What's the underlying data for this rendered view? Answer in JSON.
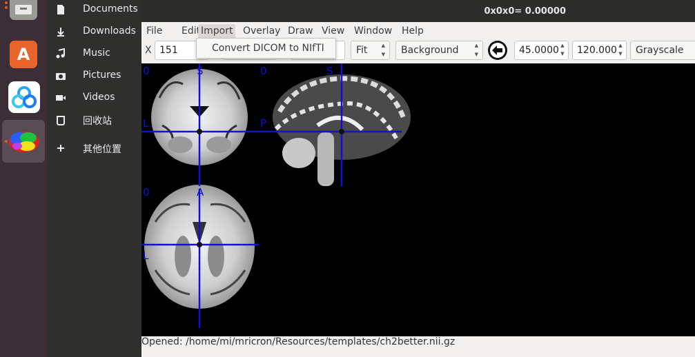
{
  "dock": {
    "apps": [
      {
        "name": "files-app-icon",
        "active": false,
        "running": true
      },
      {
        "name": "software-center-icon",
        "active": false,
        "running": false
      },
      {
        "name": "baidu-netdisk-icon",
        "active": false,
        "running": false
      },
      {
        "name": "mricron-app-icon",
        "active": true,
        "running": true
      }
    ]
  },
  "sidebar": {
    "items": [
      {
        "label": "Documents",
        "icon": "document-icon"
      },
      {
        "label": "Downloads",
        "icon": "download-icon"
      },
      {
        "label": "Music",
        "icon": "music-icon"
      },
      {
        "label": "Pictures",
        "icon": "camera-icon"
      },
      {
        "label": "Videos",
        "icon": "video-icon"
      },
      {
        "label": "回收站",
        "icon": "trash-icon"
      },
      {
        "label": "其他位置",
        "icon": "plus-icon"
      }
    ]
  },
  "window": {
    "title": "0x0x0= 0.00000"
  },
  "menubar": {
    "items": [
      "File",
      "Edit",
      "Import",
      "Overlay",
      "Draw",
      "View",
      "Window",
      "Help"
    ],
    "open_menu": "Import"
  },
  "import_menu": {
    "items": [
      "Convert DICOM to NIfTI"
    ]
  },
  "toolbar": {
    "x_label": "X",
    "x_value": "151",
    "zoom_mode": "Fit",
    "layer": "Background",
    "min_value": "45.0000",
    "max_value": "120.000",
    "colormap": "Grayscale"
  },
  "viewer": {
    "orientation_labels": {
      "coronal_zero": "0",
      "coronal_s": "S",
      "coronal_l": "L",
      "sagittal_zero": "0",
      "sagittal_s": "S",
      "sagittal_p": "P",
      "axial_zero": "0",
      "axial_a": "A",
      "axial_l": "L"
    },
    "crosshair_color": "#1010d8"
  },
  "status": {
    "text": "Opened: /home/mi/mricron/Resources/templates/ch2better.nii.gz"
  }
}
